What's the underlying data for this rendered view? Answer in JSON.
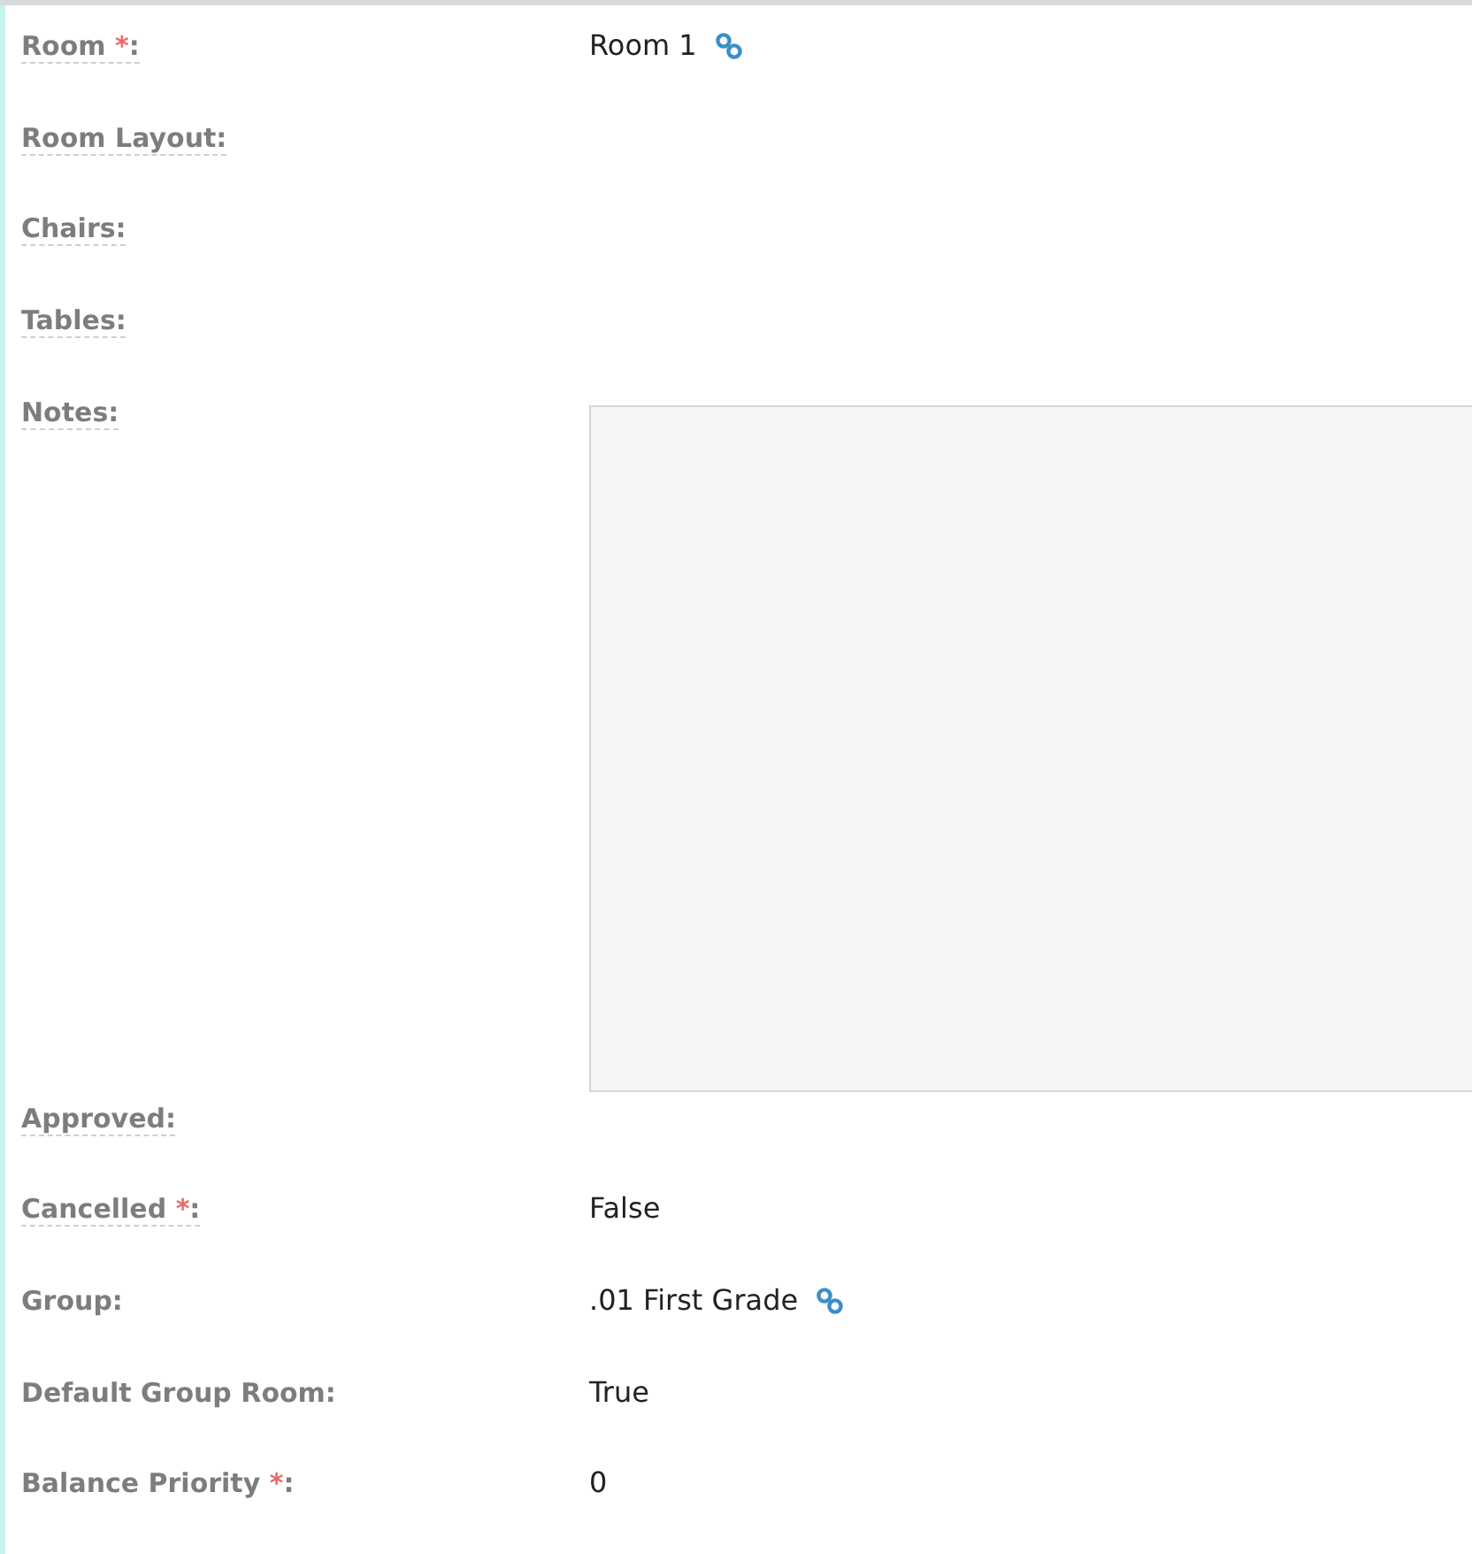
{
  "fields": [
    {
      "label": "Room",
      "required_mark": "*",
      "label_end": ":",
      "underlined": true,
      "kind": "link",
      "value": "Room 1"
    },
    {
      "label": "Room Layout:",
      "underlined": true,
      "kind": "empty"
    },
    {
      "label": "Chairs:",
      "underlined": true,
      "kind": "empty"
    },
    {
      "label": "Tables:",
      "underlined": true,
      "kind": "empty"
    },
    {
      "label": "Notes:",
      "underlined": true,
      "kind": "textarea"
    },
    {
      "label": "Approved:",
      "underlined": true,
      "kind": "empty"
    },
    {
      "label": "Cancelled",
      "required_mark": "*",
      "label_end": ":",
      "underlined": true,
      "kind": "text",
      "value": "False"
    },
    {
      "label": "Group:",
      "underlined": false,
      "kind": "link",
      "value": ".01 First Grade"
    },
    {
      "label": "Default Group Room:",
      "underlined": false,
      "kind": "text",
      "value": "True"
    },
    {
      "label": "Balance Priority",
      "required_mark": "*",
      "label_end": ":",
      "underlined": false,
      "kind": "text",
      "value": "0"
    }
  ]
}
